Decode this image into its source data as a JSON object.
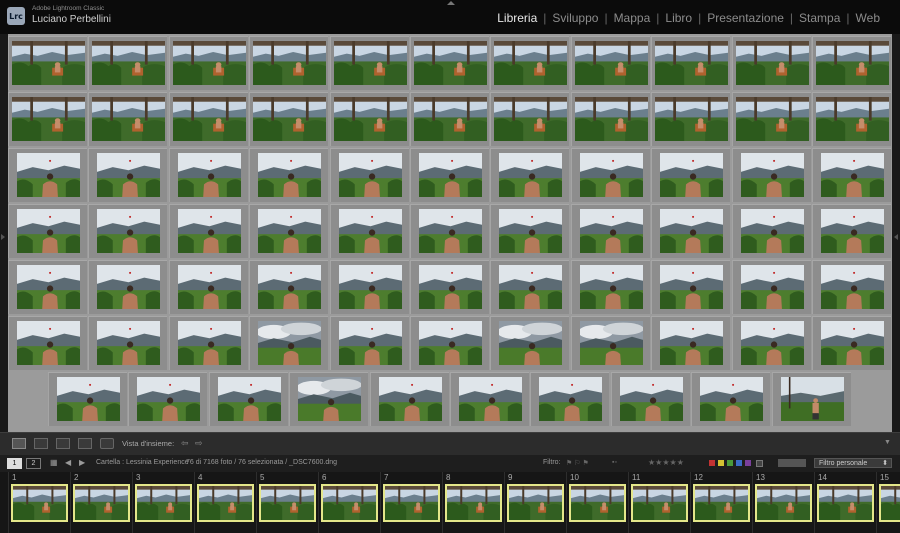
{
  "app": {
    "name": "Adobe Lightroom Classic",
    "user": "Luciano Perbellini",
    "logo": "Lrc"
  },
  "modules": [
    "Libreria",
    "Sviluppo",
    "Mappa",
    "Libro",
    "Presentazione",
    "Stampa",
    "Web"
  ],
  "active_module": "Libreria",
  "grid": {
    "rows": [
      [
        "wide",
        "wide",
        "wide",
        "wide",
        "wide",
        "wide",
        "wide",
        "wide",
        "wide",
        "wide",
        "wide"
      ],
      [
        "wide",
        "wide",
        "wide",
        "wide",
        "wide",
        "wide",
        "wide",
        "wide",
        "wide",
        "wide",
        "wide"
      ],
      [
        "back",
        "back",
        "back",
        "back",
        "back",
        "back",
        "back",
        "back",
        "back",
        "back",
        "back"
      ],
      [
        "back",
        "back",
        "back",
        "back",
        "back",
        "back",
        "back",
        "back",
        "back",
        "back",
        "back"
      ],
      [
        "back",
        "back",
        "back",
        "back",
        "back",
        "back",
        "back",
        "back",
        "back",
        "back",
        "back"
      ],
      [
        "back",
        "back",
        "back",
        "cloud",
        "back",
        "back",
        "cloud",
        "cloud",
        "back",
        "back",
        "back"
      ],
      [
        "back",
        "back",
        "back",
        "cloud",
        "back",
        "back",
        "back",
        "back",
        "back",
        "front"
      ]
    ]
  },
  "toolbar": {
    "label": "Vista d'insieme:",
    "icons": [
      "grid-view-icon",
      "loupe-view-icon",
      "compare-view-icon",
      "survey-view-icon",
      "people-view-icon"
    ]
  },
  "filmstrip_bar": {
    "page1": "1",
    "page2": "2",
    "source": "Cartella : Lessinia Experience",
    "count": "76 di 7168 foto / 76 selezionata / _DSC7600.dng",
    "filter_label": "Filtro:",
    "filter_value": "Filtro personale",
    "stars": "★★★★★",
    "colors": [
      "#c33333",
      "#d4c232",
      "#4a9a3a",
      "#3b6bc6",
      "#7a3f9c"
    ]
  },
  "filmstrip": {
    "numbers": [
      "1",
      "2",
      "3",
      "4",
      "5",
      "6",
      "7",
      "8",
      "9",
      "10",
      "11",
      "12",
      "13",
      "14",
      "15"
    ]
  }
}
